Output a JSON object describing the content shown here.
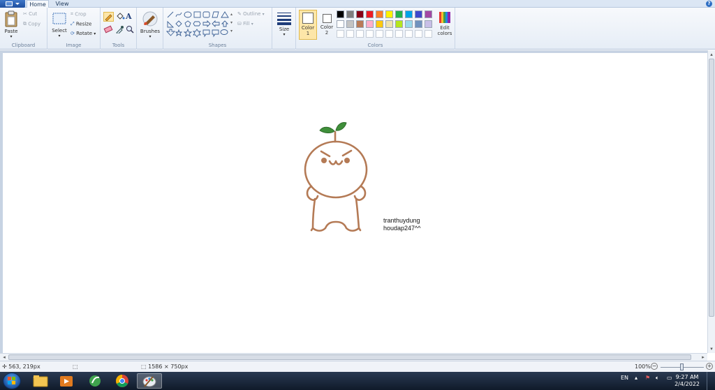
{
  "tabs": [
    {
      "label": "Home",
      "active": true
    },
    {
      "label": "View",
      "active": false
    }
  ],
  "help_label": "?",
  "groups": {
    "clipboard": {
      "label": "Clipboard",
      "paste": "Paste",
      "cut": "Cut",
      "copy": "Copy"
    },
    "image": {
      "label": "Image",
      "select": "Select",
      "crop": "Crop",
      "resize": "Resize",
      "rotate": "Rotate"
    },
    "tools": {
      "label": "Tools"
    },
    "brushes": {
      "label": "Brushes"
    },
    "shapes": {
      "label": "Shapes",
      "outline": "Outline",
      "fill": "Fill"
    },
    "size": {
      "label": "Size"
    },
    "colors": {
      "label": "Colors",
      "color1": "Color\n1",
      "color1_l1": "Color",
      "color1_l2": "1",
      "color2_l1": "Color",
      "color2_l2": "2",
      "edit_l1": "Edit",
      "edit_l2": "colors",
      "color1_value": "#ffffff",
      "color2_value": "#ffffff",
      "palette_row1": [
        "#000000",
        "#7f7f7f",
        "#880015",
        "#ed1c24",
        "#ff7f27",
        "#fff200",
        "#22b14c",
        "#00a2e8",
        "#3f48cc",
        "#a349a4"
      ],
      "palette_row2": [
        "#ffffff",
        "#c3c3c3",
        "#b97a57",
        "#ffaec9",
        "#ffc90e",
        "#efe4b0",
        "#b5e61d",
        "#99d9ea",
        "#7092be",
        "#c8bfe7"
      ]
    }
  },
  "canvas": {
    "text_line1": "tranthuydung",
    "text_line2": "houdap247^^",
    "stroke_color": "#b47a55",
    "leaf_color": "#3f8f3a"
  },
  "status": {
    "cursor_pos": "563, 219px",
    "image_size": "1586 × 750px",
    "zoom": "100%"
  },
  "taskbar": {
    "language": "EN",
    "time": "9:27 AM",
    "date": "2/4/2022"
  }
}
